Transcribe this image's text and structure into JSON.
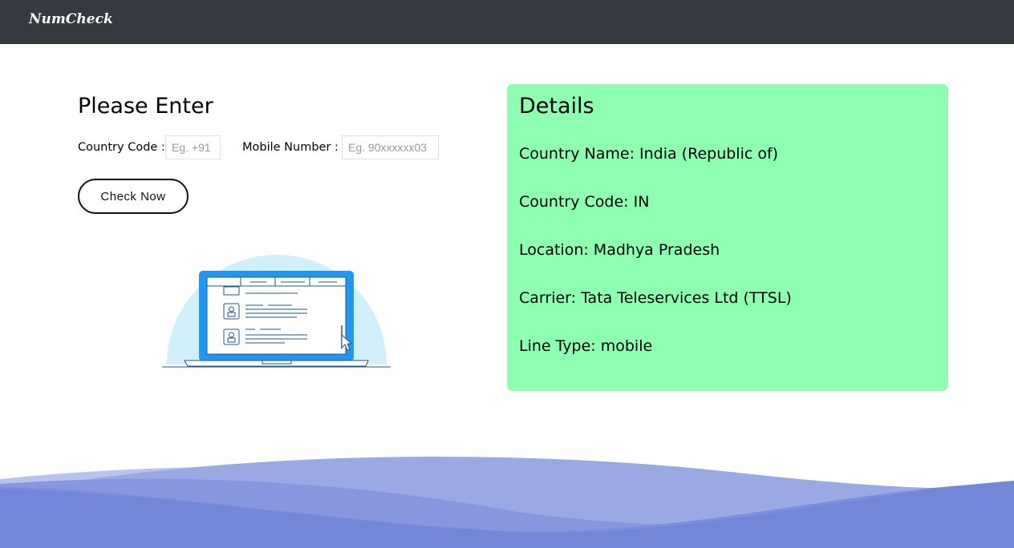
{
  "navbar": {
    "brand": "NumCheck"
  },
  "form": {
    "heading": "Please Enter",
    "country_code_label": "Country Code :",
    "country_code_placeholder": "Eg. +91",
    "mobile_label": "Mobile Number :",
    "mobile_placeholder": "Eg. 90xxxxxx03",
    "submit_label": "Check Now"
  },
  "details": {
    "title": "Details",
    "lines": [
      "Country Name: India (Republic of)",
      "Country Code: IN",
      "Location: Madhya Pradesh",
      "Carrier: Tata Teleservices Ltd (TTSL)",
      "Line Type: mobile"
    ]
  },
  "colors": {
    "navbar": "#343a40",
    "details_bg": "#8effb1",
    "wave": "#7b8fdc"
  }
}
